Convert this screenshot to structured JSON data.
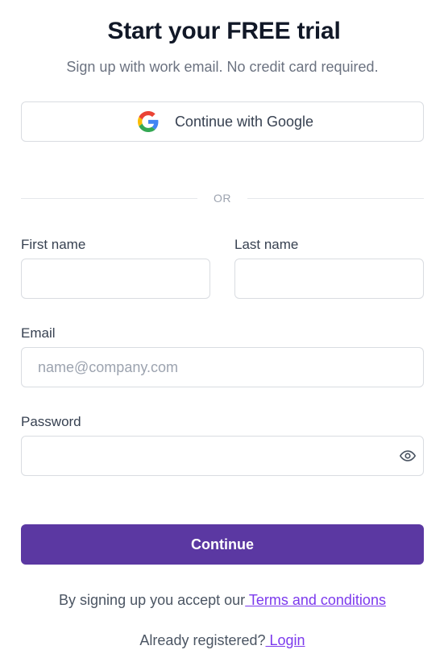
{
  "header": {
    "title": "Start your FREE trial",
    "subtitle": "Sign up with work email. No credit card required."
  },
  "google": {
    "label": "Continue with Google",
    "icon": "google-logo-icon"
  },
  "divider": {
    "text": "OR"
  },
  "form": {
    "first_name": {
      "label": "First name",
      "value": "",
      "placeholder": ""
    },
    "last_name": {
      "label": "Last name",
      "value": "",
      "placeholder": ""
    },
    "email": {
      "label": "Email",
      "value": "",
      "placeholder": "name@company.com"
    },
    "password": {
      "label": "Password",
      "value": "",
      "placeholder": "",
      "toggle_icon": "eye-icon"
    },
    "submit_label": "Continue"
  },
  "footer": {
    "terms_prefix": "By signing up you accept our",
    "terms_link": " Terms and conditions",
    "login_prefix": "Already registered?",
    "login_link": " Login"
  },
  "colors": {
    "primary": "#5b38a2",
    "link": "#7c3aed",
    "border": "#d9dce1",
    "muted_text": "#6b7280"
  }
}
